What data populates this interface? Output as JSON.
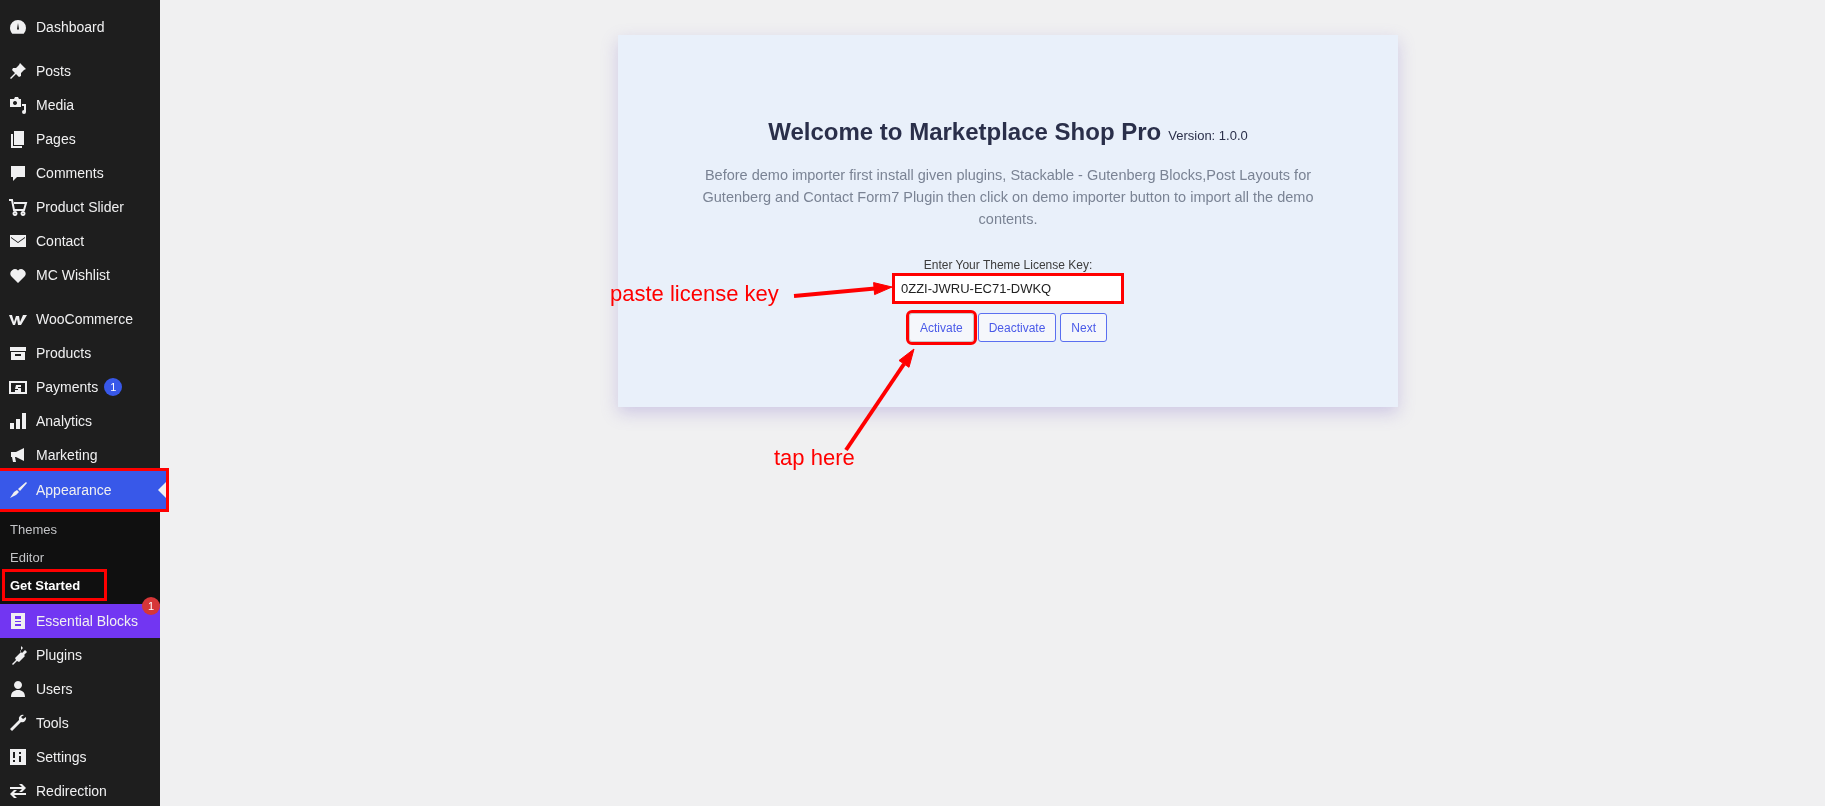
{
  "sidebar": {
    "groups": [
      {
        "items": [
          {
            "label": "Dashboard",
            "selected": false,
            "marked": false
          }
        ]
      },
      {
        "items": [
          {
            "label": "Posts",
            "selected": false,
            "marked": false
          },
          {
            "label": "Media",
            "selected": false,
            "marked": false
          },
          {
            "label": "Pages",
            "selected": false,
            "marked": false
          },
          {
            "label": "Comments",
            "selected": false,
            "marked": false
          },
          {
            "label": "Product Slider",
            "selected": false,
            "marked": false
          },
          {
            "label": "Contact",
            "selected": false,
            "marked": false
          },
          {
            "label": "MC Wishlist",
            "selected": false,
            "marked": false
          }
        ]
      },
      {
        "items": [
          {
            "label": "WooCommerce",
            "selected": false,
            "marked": false
          },
          {
            "label": "Products",
            "selected": false,
            "marked": false
          },
          {
            "label": "Payments",
            "selected": false,
            "marked": false,
            "badge": {
              "text": "1",
              "color": "#3858e9"
            }
          },
          {
            "label": "Analytics",
            "selected": false,
            "marked": false
          },
          {
            "label": "Marketing",
            "selected": false,
            "marked": false
          },
          {
            "label": "Appearance",
            "selected": true,
            "marked": true,
            "children": [
              {
                "label": "Themes",
                "selected": false,
                "marked": false
              },
              {
                "label": "Editor",
                "selected": false,
                "marked": false
              },
              {
                "label": "Get Started",
                "selected": true,
                "marked": true
              }
            ]
          },
          {
            "label": "Essential Blocks",
            "selected": false,
            "marked": false,
            "color": "#7236f2",
            "badge": {
              "text": "1",
              "color": "#d63638"
            }
          },
          {
            "label": "Plugins",
            "selected": false,
            "marked": false
          },
          {
            "label": "Users",
            "selected": false,
            "marked": false
          },
          {
            "label": "Tools",
            "selected": false,
            "marked": false
          },
          {
            "label": "Settings",
            "selected": false,
            "marked": false
          },
          {
            "label": "Redirection",
            "selected": false,
            "marked": false
          }
        ]
      }
    ]
  },
  "card": {
    "title": "Welcome to Marketplace Shop Pro",
    "version": "Version: 1.0.0",
    "description": "Before demo importer first install given plugins, Stackable - Gutenberg Blocks,Post Layouts for Gutenberg and Contact Form7 Plugin then click on demo importer button to import all the demo contents.",
    "license": {
      "label": "Enter Your Theme License Key:",
      "value": "0ZZI-JWRU-EC71-DWKQ",
      "marked": true
    },
    "buttons": [
      {
        "label": "Activate",
        "marked": true
      },
      {
        "label": "Deactivate",
        "marked": false
      },
      {
        "label": "Next",
        "marked": false
      }
    ]
  },
  "annotations": [
    {
      "text": "paste license key"
    },
    {
      "text": "tap here"
    }
  ]
}
